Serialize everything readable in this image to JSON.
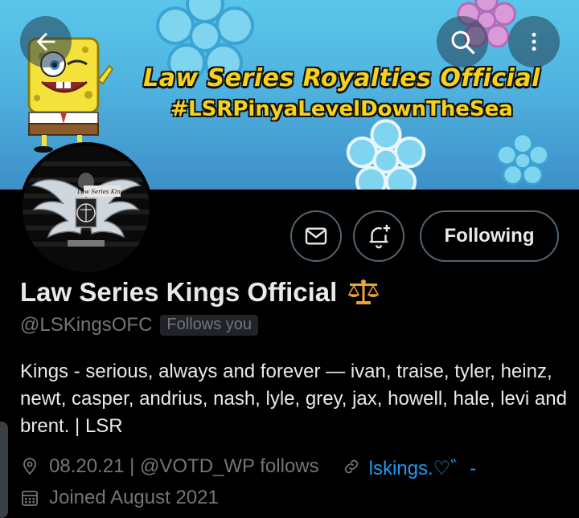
{
  "banner": {
    "title": "Law Series Royalties Official",
    "hashtag": "#LSRPinyaLevelDownTheSea",
    "sky_color": "#4fb3df",
    "title_color": "#f6d21a"
  },
  "nav": {
    "back_icon": "arrow-left-icon",
    "search_icon": "search-icon",
    "more_icon": "more-vertical-icon"
  },
  "profile": {
    "avatar_text": "Law Series Kings",
    "display_name": "Law Series Kings Official",
    "name_emoji": "⚖️",
    "handle": "@LSKingsOFC",
    "follows_you": "Follows you",
    "bio": "Kings - serious, always and forever — ivan, traise, tyler, heinz, newt, casper, andrius, nash, lyle, grey, jax, howell, hale, levi and brent. | LSR",
    "location": "08.20.21 | @VOTD_WP follows",
    "link": "lskings.♡゛-",
    "joined": "Joined August 2021"
  },
  "actions": {
    "following_label": "Following",
    "message_icon": "envelope-icon",
    "notify_icon": "bell-plus-icon"
  },
  "colors": {
    "background": "#000000",
    "text": "#e7e9ea",
    "muted": "#71767b",
    "link": "#1d9bf0",
    "border": "#536471"
  }
}
